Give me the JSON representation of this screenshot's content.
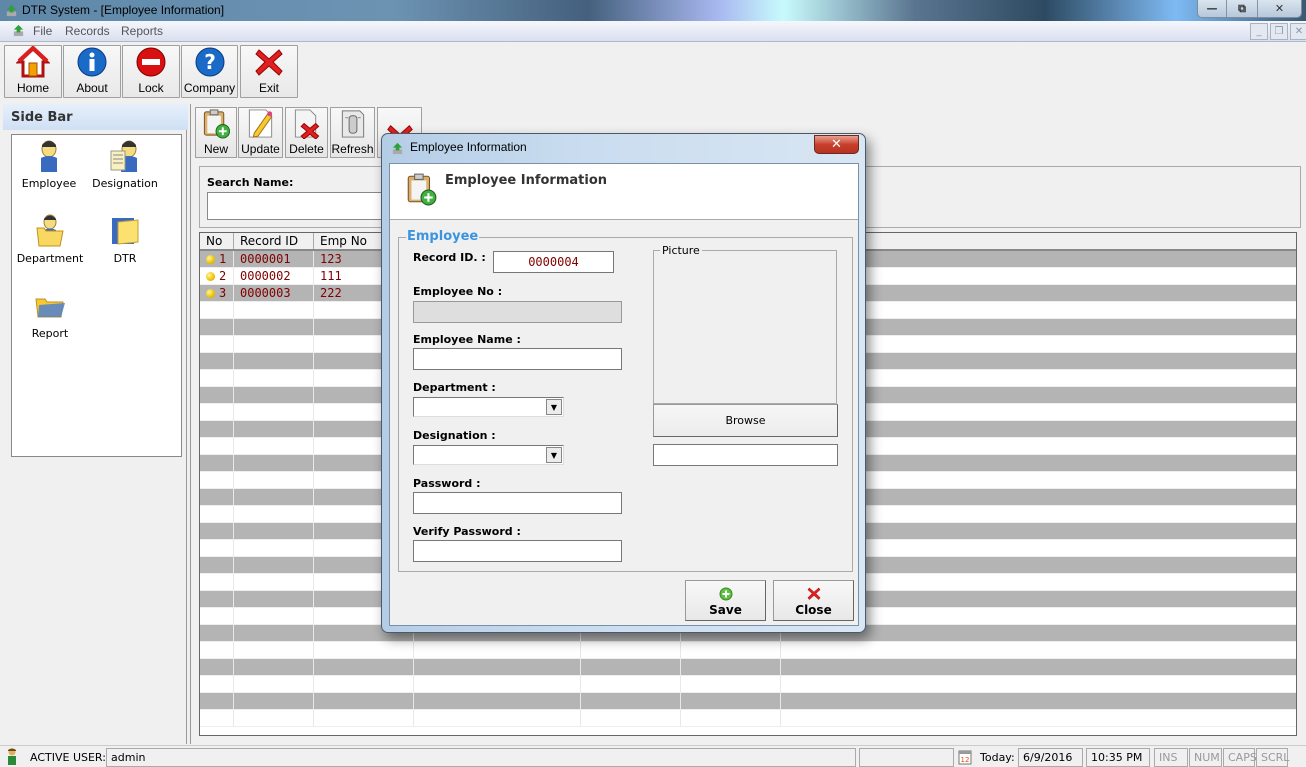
{
  "window": {
    "title": "DTR System - [Employee Information]",
    "controls": {
      "minimize": "—",
      "restore": "⧉",
      "close": "✕"
    }
  },
  "menu": {
    "items": [
      "File",
      "Records",
      "Reports"
    ],
    "mdi_controls": {
      "minimize": "_",
      "restore": "❒",
      "close": "✕"
    }
  },
  "toolbar": {
    "buttons": [
      {
        "label": "Home",
        "icon": "home-icon"
      },
      {
        "label": "About",
        "icon": "info-icon"
      },
      {
        "label": "Lock",
        "icon": "lock-icon"
      },
      {
        "label": "Company",
        "icon": "help-icon"
      },
      {
        "label": "Exit",
        "icon": "exit-icon"
      }
    ]
  },
  "sidebar": {
    "title": "Side Bar",
    "items": [
      {
        "label": "Employee",
        "icon": "employee-icon"
      },
      {
        "label": "Designation",
        "icon": "designation-icon"
      },
      {
        "label": "Department",
        "icon": "department-icon"
      },
      {
        "label": "DTR",
        "icon": "dtr-icon"
      },
      {
        "label": "Report",
        "icon": "report-icon"
      }
    ]
  },
  "records_toolbar": {
    "buttons": [
      {
        "label": "New",
        "icon": "new-record-icon"
      },
      {
        "label": "Update",
        "icon": "update-icon"
      },
      {
        "label": "Delete",
        "icon": "delete-icon"
      },
      {
        "label": "Refresh",
        "icon": "refresh-icon"
      }
    ]
  },
  "search": {
    "label": "Search Name:",
    "value": ""
  },
  "grid": {
    "columns": [
      "No",
      "Record ID",
      "Emp No"
    ],
    "rows": [
      {
        "no": "1",
        "record_id": "0000001",
        "emp_no": "123"
      },
      {
        "no": "2",
        "record_id": "0000002",
        "emp_no": "111"
      },
      {
        "no": "3",
        "record_id": "0000003",
        "emp_no": "222"
      }
    ]
  },
  "dialog": {
    "title": "Employee Information",
    "header_title": "Employee Information",
    "close_glyph": "✕",
    "group_title": "Employee",
    "fields": {
      "record_id": {
        "label": "Record ID. :",
        "value": "0000004"
      },
      "employee_no": {
        "label": "Employee No :",
        "value": ""
      },
      "employee_name": {
        "label": "Employee Name :",
        "value": ""
      },
      "department": {
        "label": "Department :",
        "value": ""
      },
      "designation": {
        "label": "Designation :",
        "value": ""
      },
      "password": {
        "label": "Password :",
        "value": ""
      },
      "verify_password": {
        "label": "Verify Password :",
        "value": ""
      }
    },
    "picture": {
      "label": "Picture",
      "browse_label": "Browse",
      "path_value": ""
    },
    "save_label": "Save",
    "close_label": "Close"
  },
  "status": {
    "active_user_label": "ACTIVE USER:",
    "active_user": "admin",
    "today_label": "Today:",
    "date": "6/9/2016",
    "time": "10:35 PM",
    "indicators": [
      "INS",
      "NUM",
      "CAPS",
      "SCRL"
    ]
  }
}
